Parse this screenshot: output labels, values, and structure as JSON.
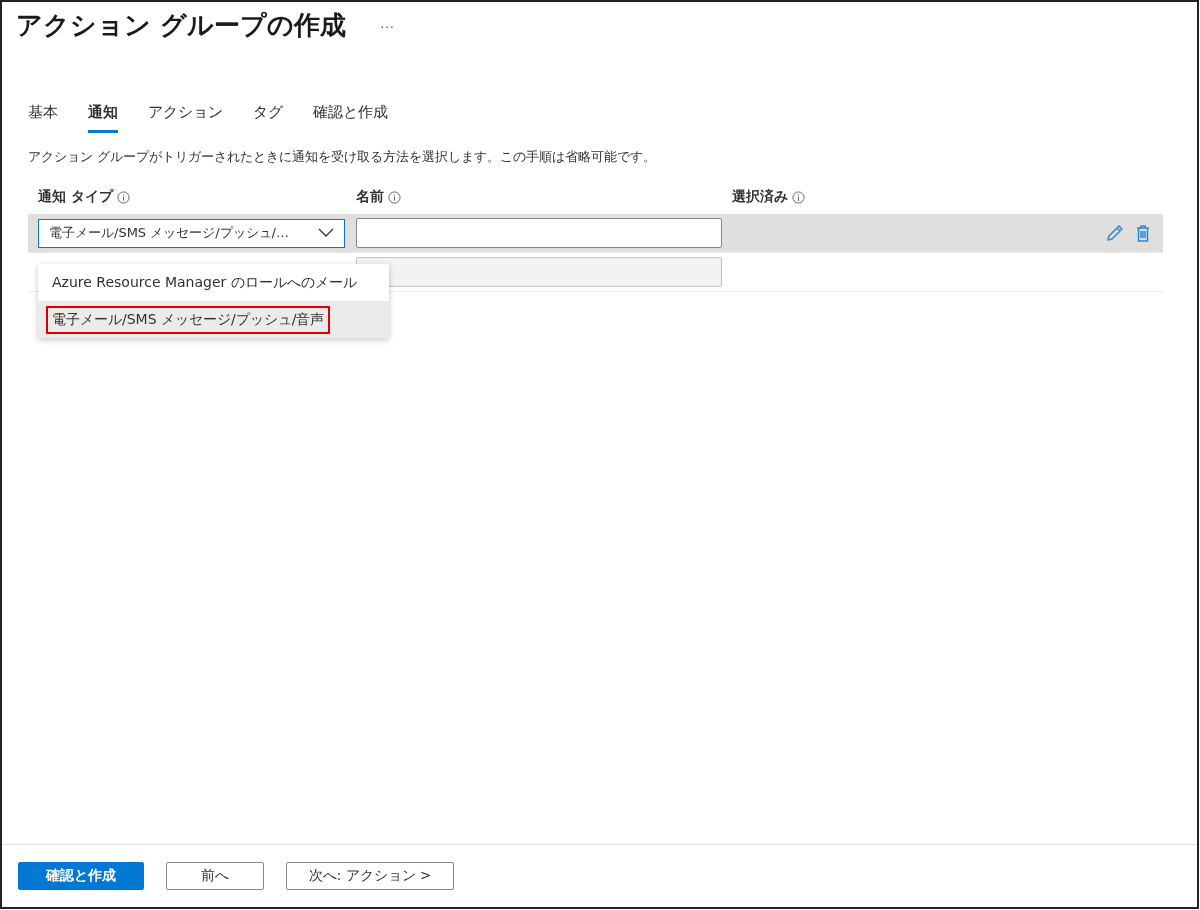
{
  "window": {
    "title": "アクション グループの作成",
    "more": "···"
  },
  "tabs": [
    {
      "label": "基本",
      "selected": false
    },
    {
      "label": "通知",
      "selected": true
    },
    {
      "label": "アクション",
      "selected": false
    },
    {
      "label": "タグ",
      "selected": false
    },
    {
      "label": "確認と作成",
      "selected": false
    }
  ],
  "description": "アクション グループがトリガーされたときに通知を受け取る方法を選択します。この手順は省略可能です。",
  "table": {
    "columns": [
      {
        "label": "通知 タイプ"
      },
      {
        "label": "名前"
      },
      {
        "label": "選択済み"
      }
    ],
    "rows": [
      {
        "selected": true,
        "type": {
          "value": "電子メール/SMS メッセージ/プッシュ/…",
          "expanded": true
        },
        "name": {
          "disabled": false
        },
        "actions": true
      },
      {
        "selected": false,
        "name": {
          "disabled": true
        },
        "actions": false
      }
    ]
  },
  "dropdown_menu": {
    "options": [
      {
        "label": "Azure Resource Manager のロールへのメール",
        "selected": false,
        "highlighted": false
      },
      {
        "label": "電子メール/SMS メッセージ/プッシュ/音声",
        "selected": true,
        "highlighted": true
      }
    ]
  },
  "footer": {
    "buttons": [
      {
        "label": "確認と作成",
        "kind": "primary"
      },
      {
        "label": "前へ",
        "kind": "secondary"
      },
      {
        "label": "次へ: アクション >",
        "kind": "secondary"
      }
    ]
  }
}
